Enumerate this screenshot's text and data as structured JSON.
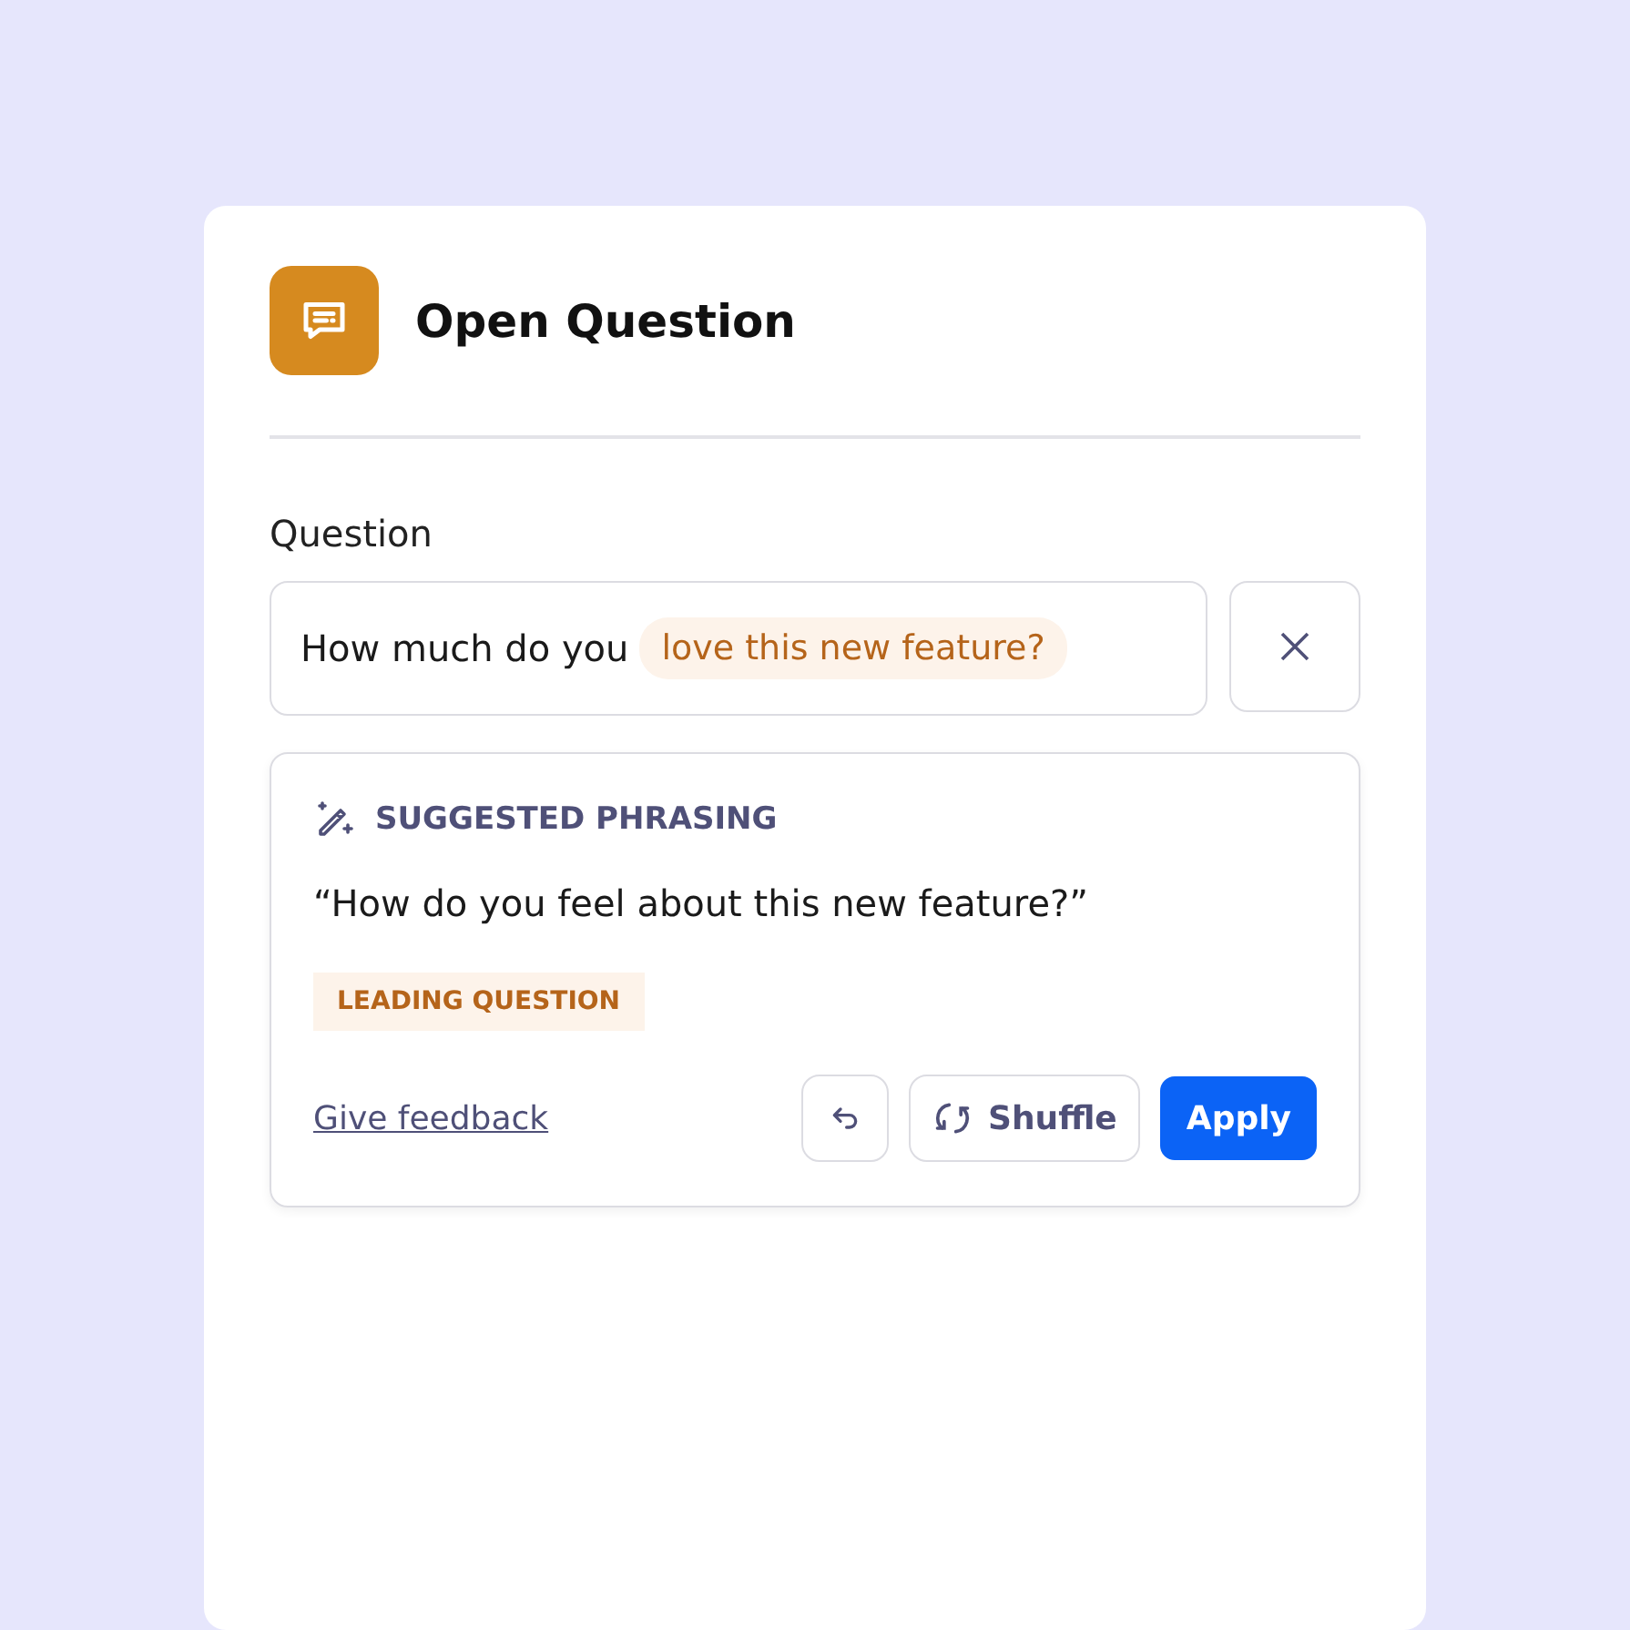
{
  "card": {
    "title": "Open Question"
  },
  "question": {
    "label": "Question",
    "segments": [
      {
        "text": "How much do you",
        "highlighted": false
      },
      {
        "text": "love this new feature?",
        "highlighted": true
      }
    ]
  },
  "suggestion": {
    "heading": "SUGGESTED PHRASING",
    "text": "“How do you feel about this new feature?”",
    "tag": "LEADING QUESTION",
    "feedback_link": "Give feedback",
    "shuffle_label": "Shuffle",
    "apply_label": "Apply"
  }
}
